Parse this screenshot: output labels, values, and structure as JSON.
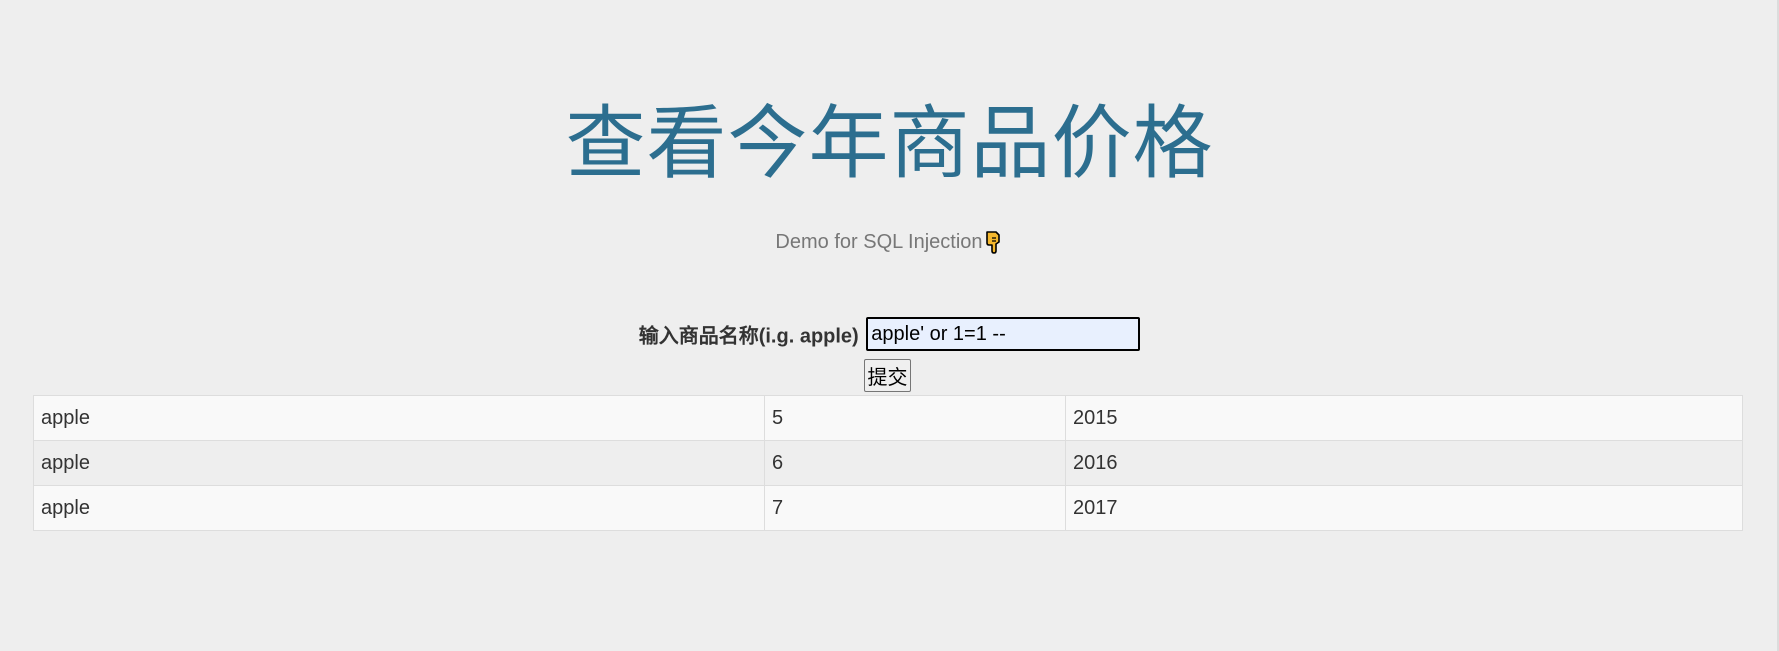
{
  "page": {
    "title": "查看今年商品价格",
    "subtitle": "Demo for SQL Injection",
    "subtitle_icon": "pointing-down-hand-icon"
  },
  "form": {
    "label": "输入商品名称(i.g. apple)",
    "query_value": "apple' or 1=1 --",
    "submit_label": "提交"
  },
  "results": {
    "rows": [
      [
        "apple",
        "5",
        "2015"
      ],
      [
        "apple",
        "6",
        "2016"
      ],
      [
        "apple",
        "7",
        "2017"
      ]
    ]
  },
  "colors": {
    "title": "#2c6e8f",
    "background": "#eeeeee",
    "input_background": "#e8f0fe",
    "icon_fill": "#f5b82e"
  }
}
